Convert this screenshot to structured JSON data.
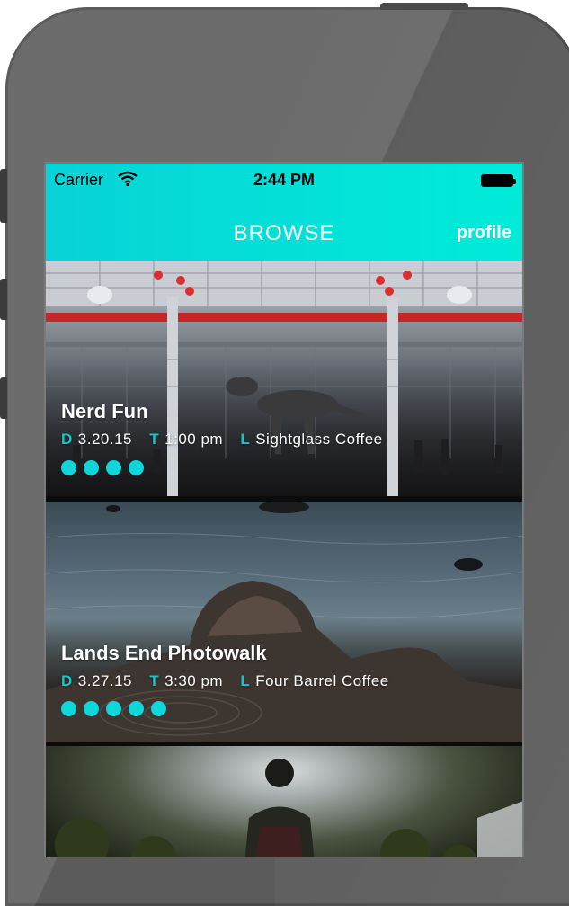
{
  "status_bar": {
    "carrier": "Carrier",
    "time": "2:44 PM"
  },
  "nav": {
    "title": "BROWSE",
    "profile": "profile"
  },
  "labels": {
    "date": "D",
    "time": "T",
    "location": "L"
  },
  "events": [
    {
      "title": "Nerd Fun",
      "date": "3.20.15",
      "time": "1:00 pm",
      "location": "Sightglass Coffee",
      "attendee_count": 4
    },
    {
      "title": "Lands End Photowalk",
      "date": "3.27.15",
      "time": "3:30 pm",
      "location": "Four Barrel Coffee",
      "attendee_count": 5
    }
  ],
  "colors": {
    "accent": "#0ed6da",
    "header_start": "#08d3d8",
    "header_end": "#00ecd9"
  },
  "icons": {
    "wifi": "wifi-icon",
    "battery": "battery-icon"
  }
}
